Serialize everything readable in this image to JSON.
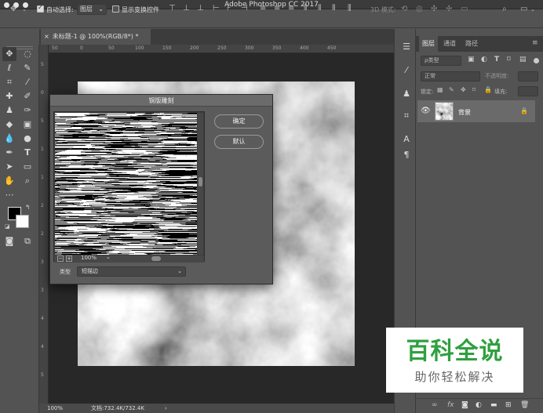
{
  "app": {
    "title": "Adobe Photoshop CC 2017"
  },
  "options_bar": {
    "auto_select_label": "自动选择:",
    "auto_select_value": "图层",
    "show_transform_label": "显示变换控件",
    "mode_3d_label": "3D 模式:"
  },
  "document": {
    "tab_label": "未标题-1 @ 100%(RGB/8*) *"
  },
  "ruler": {
    "top_ticks": [
      "50",
      "0",
      "50",
      "100",
      "150",
      "200",
      "250",
      "300",
      "350",
      "400",
      "450"
    ],
    "left_ticks": [
      "5",
      "0",
      "5",
      "1",
      "1",
      "2",
      "2",
      "3",
      "3",
      "4",
      "4",
      "5"
    ]
  },
  "status": {
    "zoom": "100%",
    "doc_info": "文档:732.4K/732.4K"
  },
  "dialog": {
    "title": "铜版雕刻",
    "ok_label": "确定",
    "default_label": "默认",
    "zoom_value": "100%",
    "type_label": "类型",
    "type_value": "短描边"
  },
  "panels": {
    "tabs": [
      "图层",
      "通道",
      "路径"
    ],
    "kind_filter": "ρ类型",
    "blend_mode": "正常",
    "opacity_label": "不透明度:",
    "lock_label": "锁定:",
    "fill_label": "填充:",
    "layer_name": "背景"
  },
  "watermark": {
    "title": "百科全说",
    "subtitle": "助你轻松解决"
  },
  "colors": {
    "accent_green": "#2fa040",
    "ui_dark": "#3b3b3b",
    "ui_mid": "#535353"
  }
}
